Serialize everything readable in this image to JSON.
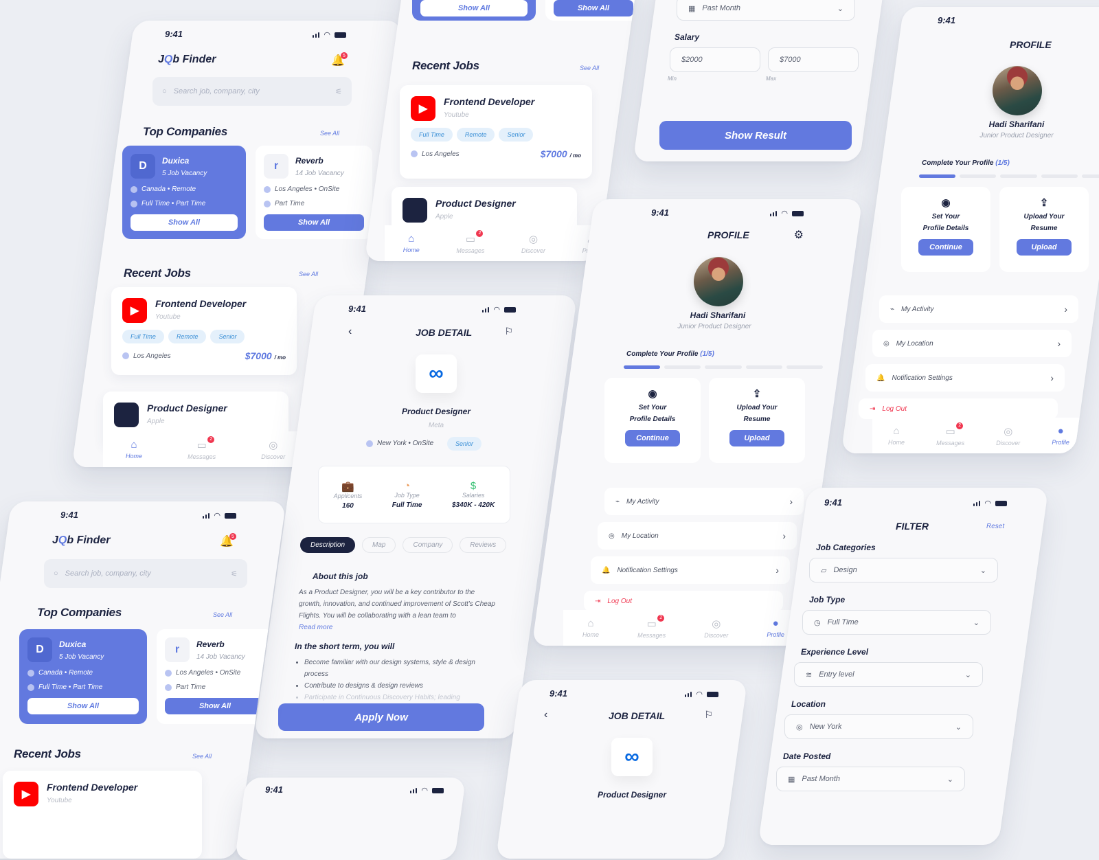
{
  "status": {
    "time": "9:41"
  },
  "home": {
    "brand_prefix": "J",
    "brand_o": "Q",
    "brand_suffix": "b Finder",
    "notification_count": "5",
    "search_placeholder": "Search job, company, city",
    "top_companies_title": "Top Companies",
    "see_all": "See All",
    "recent_jobs_title": "Recent Jobs",
    "companies": [
      {
        "name": "Duxica",
        "vacancy": "5 Job Vacancy",
        "location": "Canada • Remote",
        "type": "Full Time • Part Time",
        "button": "Show All"
      },
      {
        "name": "Reverb",
        "vacancy": "14 Job Vacancy",
        "location": "Los Angeles • OnSite",
        "type": "Part Time",
        "button": "Show All"
      }
    ],
    "jobs": [
      {
        "title": "Frontend Developer",
        "company": "Youtube",
        "tags": [
          "Full Time",
          "Remote",
          "Senior"
        ],
        "location": "Los Angeles",
        "price": "$7000",
        "period": "/ mo"
      },
      {
        "title": "Product Designer",
        "company": "Apple"
      }
    ]
  },
  "nav": {
    "items": [
      {
        "label": "Home"
      },
      {
        "label": "Messages",
        "badge": "2"
      },
      {
        "label": "Discover"
      },
      {
        "label": "Profile"
      }
    ]
  },
  "job_detail": {
    "title": "JOB DETAIL",
    "job_title": "Product Designer",
    "company": "Meta",
    "location": "New York • OnSite",
    "level": "Senior",
    "stats": [
      {
        "label": "Applicents",
        "value": "160"
      },
      {
        "label": "Job Type",
        "value": "Full Time"
      },
      {
        "label": "Salaries",
        "value": "$340K - 420K"
      }
    ],
    "tabs": [
      "Description",
      "Map",
      "Company",
      "Reviews"
    ],
    "about_title": "About this job",
    "about_text": "As a Product Designer, you will be a key contributor to the growth, innovation, and continued improvement of Scott's Cheap Flights. You will be collaborating with a lean team to",
    "read_more": "Read more",
    "short_term_title": "In the short term, you will",
    "bullets": [
      "Become familiar with our design systems, style & design process",
      "Contribute to designs & design reviews",
      "Participate in Continuous Discovery Habits; leading"
    ],
    "apply": "Apply Now"
  },
  "profile": {
    "title": "PROFILE",
    "name": "Hadi Sharifani",
    "role": "Junior Product Designer",
    "complete_label": "Complete Your Profile",
    "complete_count": "(1/5)",
    "progress_done": 1,
    "progress_total": 5,
    "tasks": [
      {
        "line1": "Set Your",
        "line2": "Profile Details",
        "button": "Continue"
      },
      {
        "line1": "Upload Your",
        "line2": "Resume",
        "button": "Upload"
      }
    ],
    "menu": [
      {
        "label": "My Activity"
      },
      {
        "label": "My Location"
      },
      {
        "label": "Notification Settings"
      }
    ],
    "logout": "Log Out"
  },
  "filter": {
    "title": "FILTER",
    "reset": "Reset",
    "fields": [
      {
        "label": "Job Categories",
        "value": "Design"
      },
      {
        "label": "Job Type",
        "value": "Full Time"
      },
      {
        "label": "Experience Level",
        "value": "Entry level"
      },
      {
        "label": "Location",
        "value": "New York"
      },
      {
        "label": "Date Posted",
        "value": "Past Month"
      }
    ],
    "salary_label": "Salary",
    "salary_min": "$2000",
    "salary_max": "$7000",
    "min_label": "Min",
    "max_label": "Max",
    "show_result": "Show Result"
  },
  "colors": {
    "accent": "#6279df",
    "danger": "#f0364f",
    "text": "#1c2340",
    "youtube": "#ff0000"
  }
}
